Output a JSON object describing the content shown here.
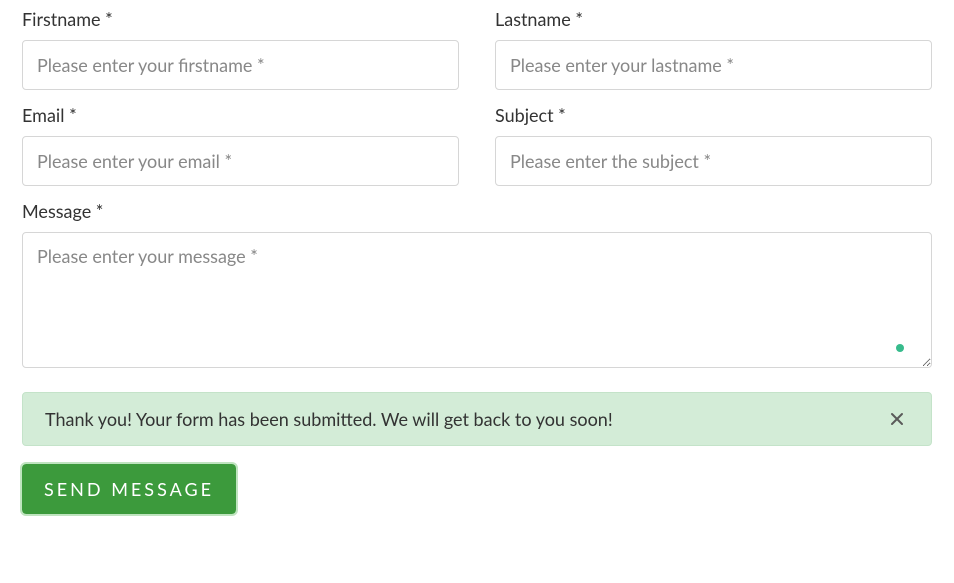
{
  "form": {
    "firstname": {
      "label": "Firstname *",
      "placeholder": "Please enter your firstname *",
      "value": ""
    },
    "lastname": {
      "label": "Lastname *",
      "placeholder": "Please enter your lastname *",
      "value": ""
    },
    "email": {
      "label": "Email *",
      "placeholder": "Please enter your email *",
      "value": ""
    },
    "subject": {
      "label": "Subject *",
      "placeholder": "Please enter the subject *",
      "value": ""
    },
    "message": {
      "label": "Message *",
      "placeholder": "Please enter your message *",
      "value": ""
    }
  },
  "alert": {
    "text": "Thank you! Your form has been submitted. We will get back to you soon!"
  },
  "submit": {
    "label": "SEND MESSAGE"
  }
}
